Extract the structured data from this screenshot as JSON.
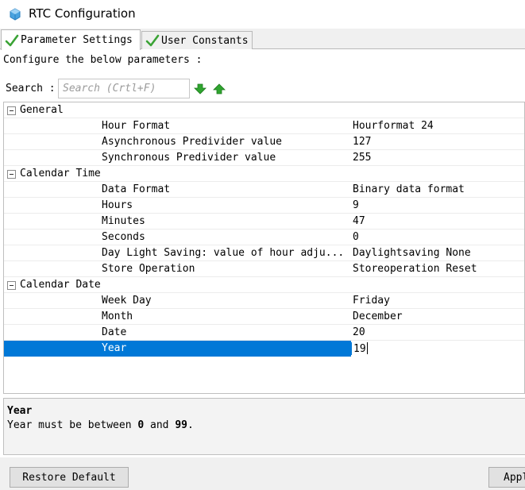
{
  "window": {
    "title": "RTC Configuration"
  },
  "tabs": [
    {
      "label": "Parameter Settings",
      "active": true
    },
    {
      "label": "User Constants",
      "active": false
    }
  ],
  "instructions": "Configure the below parameters :",
  "search": {
    "label": "Search :",
    "placeholder": "Search (Crtl+F)",
    "value": ""
  },
  "groups": [
    {
      "name": "General",
      "params": [
        {
          "name": "Hour Format",
          "value": "Hourformat 24"
        },
        {
          "name": "Asynchronous Predivider value",
          "value": "127"
        },
        {
          "name": "Synchronous Predivider value",
          "value": "255"
        }
      ]
    },
    {
      "name": "Calendar Time",
      "params": [
        {
          "name": "Data Format",
          "value": "Binary data format"
        },
        {
          "name": "Hours",
          "value": "9"
        },
        {
          "name": "Minutes",
          "value": "47"
        },
        {
          "name": "Seconds",
          "value": "0"
        },
        {
          "name": "Day Light Saving: value of hour adju...",
          "value": "Daylightsaving None"
        },
        {
          "name": "Store Operation",
          "value": "Storeoperation Reset"
        }
      ]
    },
    {
      "name": "Calendar Date",
      "params": [
        {
          "name": "Week Day",
          "value": "Friday"
        },
        {
          "name": "Month",
          "value": "December"
        },
        {
          "name": "Date",
          "value": "20"
        },
        {
          "name": "Year",
          "value": "19",
          "selected": true
        }
      ]
    }
  ],
  "description": {
    "title": "Year",
    "text_prefix": "Year must be between ",
    "min": "0",
    "text_mid": " and ",
    "max": "99",
    "text_suffix": "."
  },
  "buttons": {
    "restore": "Restore Default",
    "apply": "Apply"
  },
  "colors": {
    "selection": "#0078d7",
    "arrow_green": "#2fa52f",
    "check_green": "#3aa335"
  },
  "icons": {
    "app": "cube-icon",
    "tab_check": "checkmark-icon",
    "next": "arrow-down-icon",
    "prev": "arrow-up-icon"
  }
}
